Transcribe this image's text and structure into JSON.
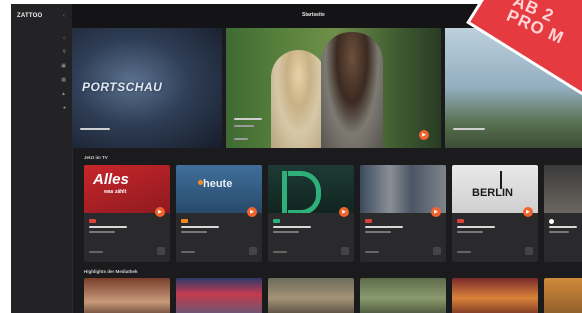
{
  "app": {
    "logo": "ZATTOO",
    "collapse_icon": "chevron-left-icon"
  },
  "header": {
    "title": "Startseite"
  },
  "sidebar": {
    "items": [
      {
        "label": "",
        "icon": "home-icon"
      },
      {
        "label": "",
        "icon": "search-icon"
      },
      {
        "label": "",
        "icon": "tv-icon"
      },
      {
        "label": "",
        "icon": "calendar-icon"
      },
      {
        "label": "",
        "icon": "bookmark-icon"
      },
      {
        "label": "",
        "icon": "record-icon"
      }
    ]
  },
  "hero": {
    "left_logo": "PORTSCHAU"
  },
  "sections": {
    "live": {
      "title": "Jetzt im TV"
    },
    "recent": {
      "title": "Highlights der Mediathek"
    }
  },
  "cards": [
    {
      "thumb_text": "Alles",
      "thumb_sub": "was zählt",
      "channel_color": "#d9423a"
    },
    {
      "thumb_text": "heute",
      "thumb_sub": "",
      "channel_color": "#f08c1e"
    },
    {
      "thumb_text": "",
      "thumb_sub": "",
      "channel_color": "#2db07a"
    },
    {
      "thumb_text": "",
      "thumb_sub": "",
      "channel_color": "#d9423a"
    },
    {
      "thumb_text": "BERLIN",
      "thumb_sub": "",
      "channel_color": "#d9423a"
    },
    {
      "thumb_text": "",
      "thumb_sub": "",
      "channel_color": "#ffffff"
    }
  ],
  "banner": {
    "text": "AB 2\nPRO M"
  },
  "colors": {
    "accent": "#f0632c",
    "background": "#1b1b1d",
    "sidebar": "#232325",
    "banner": "#e63a41"
  }
}
